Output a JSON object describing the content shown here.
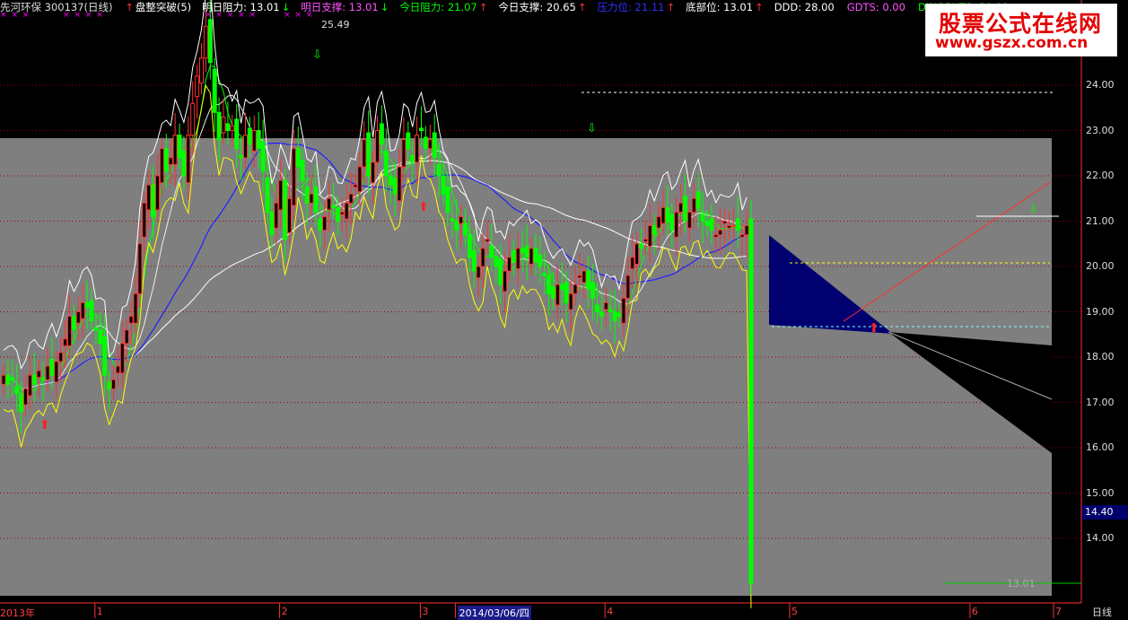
{
  "header": {
    "stock": "先河环保 300137(日线)",
    "items": [
      {
        "label": "盘整突破(5)",
        "color": "#ffffff",
        "arrow": "↑",
        "arrow_color": "#ff3030"
      },
      {
        "label": "明日阻力: 13.01",
        "color": "#ffffff",
        "arrow": "↓",
        "arrow_color": "#00ff00"
      },
      {
        "label": "明日支撑: 13.01",
        "color": "#ff55ff",
        "arrow": "↓",
        "arrow_color": "#00ff00"
      },
      {
        "label": "今日阻力: 21.07",
        "color": "#00ff00",
        "arrow": "↑",
        "arrow_color": "#ff3030"
      },
      {
        "label": "今日支撑: 20.65",
        "color": "#ffffff",
        "arrow": "↑",
        "arrow_color": "#ff3030"
      },
      {
        "label": "压力位: 21.11",
        "color": "#3030ff",
        "arrow": "↑",
        "arrow_color": "#ff3030"
      },
      {
        "label": "底部位: 13.01",
        "color": "#ffffff",
        "arrow": "↑",
        "arrow_color": "#ff3030"
      },
      {
        "label": "DDD: 28.00",
        "color": "#ffffff",
        "arrow": "",
        "arrow_color": ""
      },
      {
        "label": "GDTS: 0.00",
        "color": "#ff55ff",
        "arrow": "",
        "arrow_color": ""
      },
      {
        "label": "DINGBUTS: 29.00",
        "color": "#00ff00",
        "arrow": "",
        "arrow_color": ""
      }
    ]
  },
  "watermark": {
    "line1": "股票公式在线网",
    "line2": "www.gszx.com.cn"
  },
  "chart_data": {
    "type": "candlestick",
    "ylim": [
      13.0,
      25.0
    ],
    "y_ticks": [
      "24.00",
      "23.00",
      "22.00",
      "21.00",
      "20.00",
      "19.00",
      "18.00",
      "17.00",
      "16.00",
      "15.00",
      "14.00"
    ],
    "x_ticks": [
      {
        "label": "2013年",
        "index": 0
      },
      {
        "label": "1",
        "index": 22
      },
      {
        "label": "2",
        "index": 64
      },
      {
        "label": "3",
        "index": 96
      },
      {
        "label": "2014/03/06/四",
        "index": 104
      },
      {
        "label": "4",
        "index": 138
      },
      {
        "label": "5",
        "index": 180
      },
      {
        "label": "6",
        "index": 221
      },
      {
        "label": "7",
        "index": 240
      }
    ],
    "annotations": {
      "high_label": "25.49",
      "low_label": "13.01",
      "last_price": "14.40",
      "period": "日线"
    },
    "closes": [
      17.6,
      17.4,
      17.5,
      17.2,
      16.8,
      17.3,
      17.6,
      17.4,
      17.7,
      17.5,
      17.8,
      17.6,
      17.9,
      18.1,
      18.4,
      18.9,
      18.6,
      19.0,
      19.2,
      19.1,
      18.8,
      18.6,
      18.3,
      17.6,
      17.3,
      17.5,
      17.8,
      18.3,
      18.6,
      18.9,
      19.4,
      20.5,
      21.4,
      21.8,
      21.1,
      22.0,
      22.6,
      22.1,
      22.4,
      22.9,
      22.4,
      22.0,
      22.9,
      23.6,
      24.2,
      24.6,
      25.3,
      24.5,
      23.4,
      22.8,
      23.3,
      23.0,
      23.1,
      22.6,
      22.4,
      22.9,
      22.7,
      23.0,
      22.6,
      22.1,
      21.2,
      20.7,
      21.4,
      21.9,
      20.6,
      21.5,
      22.6,
      22.2,
      21.9,
      21.4,
      21.6,
      21.2,
      20.8,
      21.1,
      21.5,
      21.3,
      21.0,
      21.2,
      21.4,
      21.6,
      21.8,
      22.2,
      22.8,
      22.0,
      22.3,
      23.0,
      22.7,
      22.0,
      21.8,
      21.6,
      22.2,
      22.8,
      22.6,
      22.3,
      22.9,
      23.0,
      22.6,
      22.8,
      22.4,
      22.0,
      21.6,
      21.2,
      21.0,
      20.8,
      21.1,
      20.7,
      20.2,
      19.9,
      20.0,
      20.4,
      20.6,
      20.2,
      20.0,
      19.6,
      19.9,
      20.2,
      20.1,
      20.4,
      20.3,
      20.2,
      20.4,
      20.1,
      20.0,
      19.8,
      19.4,
      19.3,
      19.6,
      19.5,
      19.2,
      19.4,
      19.6,
      19.8,
      19.9,
      19.5,
      19.3,
      19.0,
      18.9,
      19.2,
      19.0,
      18.8,
      18.9,
      19.3,
      19.8,
      20.2,
      20.5,
      20.4,
      20.6,
      20.9,
      20.7,
      21.1,
      21.3,
      21.0,
      20.8,
      21.2,
      21.4,
      21.0,
      21.2,
      21.5,
      21.3,
      21.0,
      20.9,
      20.8,
      20.7,
      20.8,
      21.0,
      20.9,
      20.9,
      20.8,
      20.7,
      20.9,
      13.01
    ]
  }
}
